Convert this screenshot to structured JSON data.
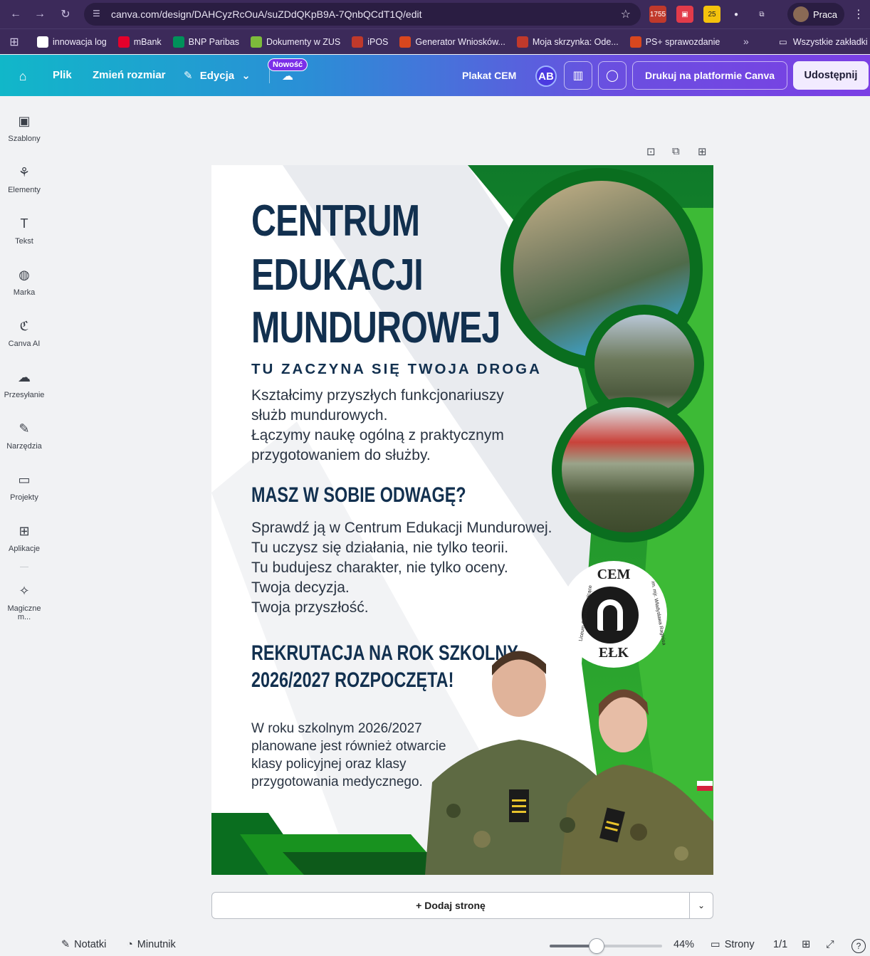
{
  "browser": {
    "url": "canva.com/design/DAHCyzRcOuA/suZDdQKpB9A-7QnbQCdT1Q/edit",
    "ext_badges": [
      "1755",
      "25"
    ],
    "profile": "Praca"
  },
  "bookmarks": [
    {
      "label": "innowacja log",
      "color": "#ffffff"
    },
    {
      "label": "mBank",
      "color": "#e4002b"
    },
    {
      "label": "BNP Paribas",
      "color": "#00915a"
    },
    {
      "label": "Dokumenty w ZUS",
      "color": "#7dbb3b"
    },
    {
      "label": "iPOS",
      "color": "#c0392b"
    },
    {
      "label": "Generator Wniosków...",
      "color": "#d9471e"
    },
    {
      "label": "Moja skrzynka: Ode...",
      "color": "#c0392b"
    },
    {
      "label": "PS+ sprawozdanie",
      "color": "#d9471e"
    }
  ],
  "bookmarks_all": "Wszystkie zakładki",
  "toolbar": {
    "file": "Plik",
    "resize": "Zmień rozmiar",
    "edit": "Edycja",
    "new_badge": "Nowość",
    "design_title": "Plakat CEM",
    "avatar": "AB",
    "print": "Drukuj na platformie Canva",
    "share": "Udostępnij"
  },
  "rail": [
    {
      "label": "Szablony",
      "icon": "templates-icon",
      "glyph": "▣"
    },
    {
      "label": "Elementy",
      "icon": "elements-icon",
      "glyph": "⚘"
    },
    {
      "label": "Tekst",
      "icon": "text-icon",
      "glyph": "T"
    },
    {
      "label": "Marka",
      "icon": "brand-icon",
      "glyph": "◍"
    },
    {
      "label": "Canva AI",
      "icon": "canva-ai-icon",
      "glyph": "ℭ"
    },
    {
      "label": "Przesyłanie",
      "icon": "upload-icon",
      "glyph": "☁"
    },
    {
      "label": "Narzędzia",
      "icon": "tools-icon",
      "glyph": "✎"
    },
    {
      "label": "Projekty",
      "icon": "projects-icon",
      "glyph": "▭"
    },
    {
      "label": "Aplikacje",
      "icon": "apps-icon",
      "glyph": "⊞"
    },
    {
      "label": "Magiczne m...",
      "icon": "magic-media-icon",
      "glyph": "✧"
    }
  ],
  "poster": {
    "title_lines": [
      "CENTRUM",
      "EDUKACJI",
      "MUNDUROWEJ"
    ],
    "subtitle": "TU ZACZYNA SIĘ TWOJA DROGA",
    "intro_lines": [
      "Kształcimy przyszłych funkcjonariuszy",
      "służb mundurowych.",
      "Łączymy naukę ogólną z praktycznym",
      "przygotowaniem do służby."
    ],
    "question": "MASZ W SOBIE ODWAGĘ?",
    "call_lines": [
      "Sprawdź ją w Centrum Edukacji Mundurowej.",
      "Tu uczysz się działania, nie tylko teorii.",
      "Tu budujesz charakter, nie tylko oceny.",
      "Twoja decyzja.",
      "Twoja przyszłość."
    ],
    "recruit_lines": [
      "REKRUTACJA NA ROK SZKOLNY",
      "2026/2027 ROZPOCZĘTA!"
    ],
    "note_lines": [
      "W roku szkolnym 2026/2027",
      "planowane jest również otwarcie",
      "klasy policyjnej oraz klasy",
      "przygotowania medycznego."
    ],
    "logo_top": "CEM",
    "logo_bottom": "EŁK",
    "logo_ring_left": "Liceum Ogólnokształcące",
    "logo_ring_right": "im. mjr. Władysława Raginisa"
  },
  "add_page": "+ Dodaj stronę",
  "footer": {
    "notes": "Notatki",
    "timer": "Minutnik",
    "zoom": "44%",
    "zoom_fraction": 0.42,
    "pages_label": "Strony",
    "page_count": "1/1",
    "help": "?"
  },
  "colors": {
    "navy": "#12304f",
    "green_dark": "#0a6e1f",
    "green_light": "#3fbf3a",
    "canva_gradient_start": "#11b7c9",
    "canva_gradient_end": "#7b3fe4"
  }
}
